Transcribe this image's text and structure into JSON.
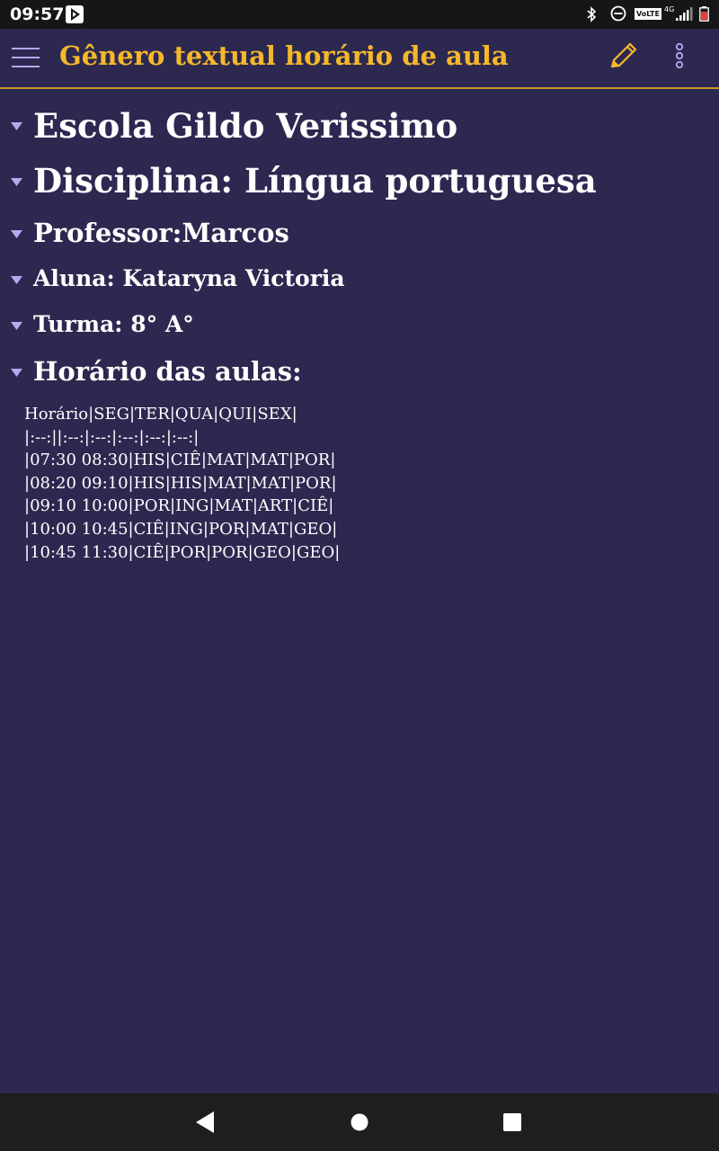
{
  "status_bar": {
    "time": "09:57",
    "volte": "VoLTE",
    "network": "4G",
    "icons": [
      "play-store-icon",
      "bluetooth-icon",
      "do-not-disturb-icon",
      "signal-icon",
      "battery-icon"
    ]
  },
  "app_bar": {
    "title": "Gênero textual horário de aula",
    "title_color": "#f5b82a",
    "accent": "#c9962c",
    "icons": [
      "menu-icon",
      "edit-pencil-icon",
      "more-vert-icon"
    ]
  },
  "headings": [
    {
      "text": "Escola Gildo Verissimo",
      "level": 1
    },
    {
      "text": "Disciplina: Língua portuguesa",
      "level": 1
    },
    {
      "text": "Professor:Marcos",
      "level": 2
    },
    {
      "text": "Aluna: Kataryna Victoria",
      "level": 3
    },
    {
      "text": "Turma: 8° A°",
      "level": 3
    },
    {
      "text": "Horário das aulas:",
      "level": 2
    }
  ],
  "schedule_lines": [
    "Horário|SEG|TER|QUA|QUI|SEX|",
    "|:--:||:--:|:--:|:--:|:--:|:--:|",
    "|07:30 08:30|HIS|CIÊ|MAT|MAT|POR|",
    "|08:20 09:10|HIS|HIS|MAT|MAT|POR|",
    "|09:10 10:00|POR|ING|MAT|ART|CIÊ|",
    "|10:00 10:45|CIÊ|ING|POR|MAT|GEO|",
    "|10:45 11:30|CIÊ|POR|POR|GEO|GEO|"
  ],
  "colors": {
    "background": "#2c2850",
    "arrow": "#b9a7f0",
    "status_bar": "#161616",
    "nav_bar": "#1e1e1e"
  },
  "nav_bar": {
    "icons": [
      "back-icon",
      "home-icon",
      "recents-icon"
    ]
  }
}
